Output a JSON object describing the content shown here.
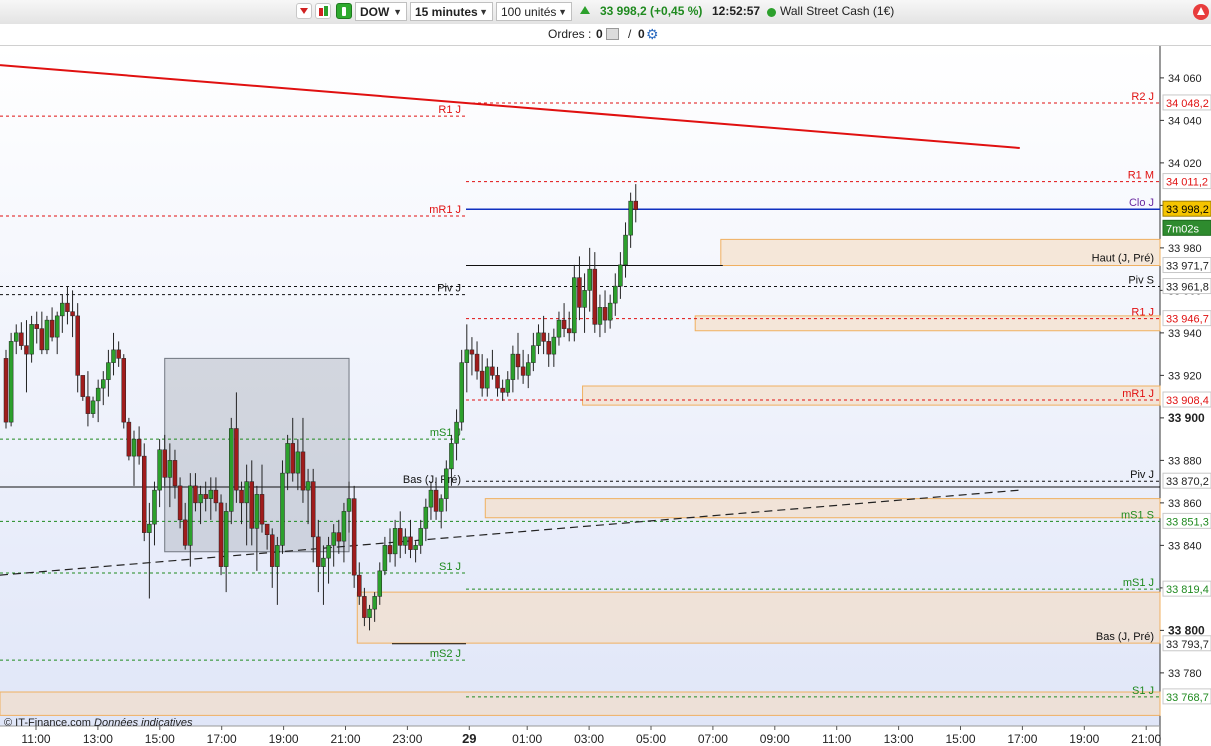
{
  "toolbar": {
    "symbol": "DOW",
    "timeframe": "15 minutes",
    "units": "100 unités",
    "price_change": "33 998,2 (+0,45 %)",
    "time": "12:52:57",
    "instrument": "Wall Street Cash (1€)"
  },
  "orders": {
    "label": "Ordres :",
    "count_a": "0",
    "sep": "/",
    "count_b": "0"
  },
  "footer": {
    "source": "© IT-Finance.com",
    "note": "Données indicatives"
  },
  "colors": {
    "up": "#2ca02c",
    "down": "#a01c1c",
    "resistance": "#e01010",
    "support": "#1f8a1f",
    "pivot": "#111111",
    "zone": "#f5dcc2",
    "zone_border": "#f0b060",
    "box": "#9aa0aa"
  },
  "chart_data": {
    "type": "line",
    "title": "",
    "y_axis": {
      "range": [
        33755,
        34075
      ],
      "tick_labels": [
        "34 060",
        "34 040",
        "34 020",
        "34 000",
        "33 980",
        "33 960",
        "33 940",
        "33 920",
        "33 900",
        "33 880",
        "33 860",
        "33 840",
        "33 820",
        "33 800",
        "33 780"
      ],
      "bold_labels": [
        "33 900",
        "33 800"
      ]
    },
    "x_axis": {
      "tick_labels": [
        "11:00",
        "13:00",
        "15:00",
        "17:00",
        "19:00",
        "21:00",
        "23:00",
        "29",
        "01:00",
        "03:00",
        "05:00",
        "07:00",
        "09:00",
        "11:00",
        "13:00",
        "15:00",
        "17:00",
        "19:00",
        "21:00"
      ],
      "bold_labels": [
        "29"
      ]
    },
    "last_price": {
      "value": "33 998,2",
      "countdown": "7m02s"
    },
    "levels": [
      {
        "label": "R2 J",
        "value": 34048.2,
        "value_label": "34 048,2",
        "kind": "resistance",
        "scope": "today"
      },
      {
        "label": "R1 J",
        "value": 34042,
        "value_label": "",
        "kind": "resistance",
        "scope": "yesterday"
      },
      {
        "label": "R1 M",
        "value": 34011.2,
        "value_label": "34 011,2",
        "kind": "resistance",
        "scope": "today"
      },
      {
        "label": "mR1 J",
        "value": 33995,
        "value_label": "",
        "kind": "resistance",
        "scope": "yesterday"
      },
      {
        "label": "Piv S",
        "value": 33961.8,
        "value_label": "33 961,8",
        "kind": "pivot",
        "scope": "all"
      },
      {
        "label": "Piv J",
        "value": 33958,
        "value_label": "",
        "kind": "pivot",
        "scope": "yesterday"
      },
      {
        "label": "R1 J",
        "value": 33946.7,
        "value_label": "33 946,7",
        "kind": "resistance",
        "scope": "today"
      },
      {
        "label": "mR1 J",
        "value": 33908.4,
        "value_label": "33 908,4",
        "kind": "resistance",
        "scope": "today"
      },
      {
        "label": "mS1 J",
        "value": 33890,
        "value_label": "",
        "kind": "support",
        "scope": "yesterday"
      },
      {
        "label": "Piv J",
        "value": 33870.2,
        "value_label": "33 870,2",
        "kind": "pivot",
        "scope": "today"
      },
      {
        "label": "mS1 S",
        "value": 33851.3,
        "value_label": "33 851,3",
        "kind": "support",
        "scope": "all"
      },
      {
        "label": "S1 J",
        "value": 33827,
        "value_label": "",
        "kind": "support",
        "scope": "yesterday"
      },
      {
        "label": "mS1 J",
        "value": 33819.4,
        "value_label": "33 819,4",
        "kind": "support",
        "scope": "today"
      },
      {
        "label": "mS2 J",
        "value": 33786,
        "value_label": "",
        "kind": "support",
        "scope": "yesterday"
      },
      {
        "label": "S1 J",
        "value": 33768.7,
        "value_label": "33 768,7",
        "kind": "support",
        "scope": "today"
      }
    ],
    "high_low": [
      {
        "label": "Haut (J, Pré)",
        "value": 33971.7,
        "value_label": "33 971,7"
      },
      {
        "label": "Bas (J, Pré)",
        "value": 33793.7,
        "value_label": "33 793,7"
      },
      {
        "label": "Bas (J, Pré)",
        "value": 33867.5,
        "value_label": ""
      }
    ],
    "right_labels": [
      "Clo J"
    ],
    "zones": [
      {
        "low": 33971.7,
        "high": 33984,
        "from_bar": 140
      },
      {
        "low": 33941,
        "high": 33948,
        "from_bar": 135
      },
      {
        "low": 33906,
        "high": 33915,
        "from_bar": 113
      },
      {
        "low": 33853,
        "high": 33862,
        "from_bar": 94
      },
      {
        "low": 33794,
        "high": 33818,
        "from_bar": 69
      },
      {
        "low": 33760,
        "high": 33771,
        "from_bar": 0
      }
    ],
    "consolidation_box": {
      "from_bar": 31,
      "to_bar": 67,
      "low": 33837,
      "high": 33928
    },
    "trendlines": [
      {
        "style": "solid",
        "color": "red",
        "points": [
          [
            0,
            34066
          ],
          [
            198,
            34027
          ]
        ]
      },
      {
        "style": "dashed",
        "color": "black",
        "points": [
          [
            0,
            33826
          ],
          [
            198,
            33866
          ]
        ]
      }
    ],
    "candles_ohlc": [
      [
        33928,
        33932,
        33895,
        33898
      ],
      [
        33898,
        33940,
        33896,
        33936
      ],
      [
        33936,
        33944,
        33930,
        33940
      ],
      [
        33940,
        33945,
        33932,
        33934
      ],
      [
        33934,
        33946,
        33912,
        33930
      ],
      [
        33930,
        33948,
        33926,
        33944
      ],
      [
        33944,
        33950,
        33935,
        33942
      ],
      [
        33942,
        33950,
        33930,
        33932
      ],
      [
        33932,
        33948,
        33930,
        33946
      ],
      [
        33946,
        33952,
        33936,
        33938
      ],
      [
        33938,
        33950,
        33930,
        33948
      ],
      [
        33948,
        33958,
        33940,
        33954
      ],
      [
        33954,
        33962,
        33944,
        33950
      ],
      [
        33950,
        33960,
        33938,
        33948
      ],
      [
        33948,
        33954,
        33912,
        33920
      ],
      [
        33920,
        33912,
        33908,
        33910
      ],
      [
        33910,
        33922,
        33896,
        33902
      ],
      [
        33902,
        33910,
        33900,
        33908
      ],
      [
        33908,
        33918,
        33898,
        33914
      ],
      [
        33914,
        33922,
        33906,
        33918
      ],
      [
        33918,
        33932,
        33910,
        33926
      ],
      [
        33926,
        33940,
        33920,
        33932
      ],
      [
        33932,
        33936,
        33924,
        33928
      ],
      [
        33928,
        33930,
        33895,
        33898
      ],
      [
        33898,
        33900,
        33880,
        33882
      ],
      [
        33882,
        33894,
        33868,
        33890
      ],
      [
        33890,
        33896,
        33878,
        33882
      ],
      [
        33882,
        33888,
        33842,
        33846
      ],
      [
        33846,
        33860,
        33815,
        33850
      ],
      [
        33850,
        33870,
        33840,
        33866
      ],
      [
        33866,
        33890,
        33858,
        33885
      ],
      [
        33885,
        33892,
        33868,
        33872
      ],
      [
        33872,
        33888,
        33858,
        33880
      ],
      [
        33880,
        33885,
        33862,
        33868
      ],
      [
        33868,
        33872,
        33848,
        33852
      ],
      [
        33852,
        33860,
        33838,
        33840
      ],
      [
        33840,
        33874,
        33830,
        33868
      ],
      [
        33868,
        33874,
        33856,
        33860
      ],
      [
        33860,
        33868,
        33850,
        33864
      ],
      [
        33864,
        33870,
        33856,
        33862
      ],
      [
        33862,
        33872,
        33852,
        33866
      ],
      [
        33866,
        33872,
        33856,
        33860
      ],
      [
        33860,
        33864,
        33826,
        33830
      ],
      [
        33830,
        33860,
        33818,
        33856
      ],
      [
        33856,
        33900,
        33850,
        33895
      ],
      [
        33895,
        33912,
        33860,
        33866
      ],
      [
        33866,
        33870,
        33850,
        33860
      ],
      [
        33860,
        33878,
        33840,
        33870
      ],
      [
        33870,
        33880,
        33840,
        33848
      ],
      [
        33848,
        33868,
        33828,
        33864
      ],
      [
        33864,
        33878,
        33846,
        33850
      ],
      [
        33850,
        33850,
        33838,
        33845
      ],
      [
        33845,
        33848,
        33820,
        33830
      ],
      [
        33830,
        33844,
        33812,
        33840
      ],
      [
        33840,
        33880,
        33836,
        33874
      ],
      [
        33874,
        33892,
        33866,
        33888
      ],
      [
        33888,
        33900,
        33870,
        33874
      ],
      [
        33874,
        33890,
        33866,
        33884
      ],
      [
        33884,
        33900,
        33860,
        33866
      ],
      [
        33866,
        33876,
        33850,
        33870
      ],
      [
        33870,
        33876,
        33832,
        33844
      ],
      [
        33844,
        33852,
        33818,
        33830
      ],
      [
        33830,
        33840,
        33812,
        33834
      ],
      [
        33834,
        33844,
        33822,
        33840
      ],
      [
        33840,
        33850,
        33830,
        33846
      ],
      [
        33846,
        33852,
        33836,
        33842
      ],
      [
        33842,
        33860,
        33832,
        33856
      ],
      [
        33856,
        33870,
        33846,
        33862
      ],
      [
        33862,
        33868,
        33820,
        33826
      ],
      [
        33826,
        33832,
        33812,
        33816
      ],
      [
        33816,
        33820,
        33802,
        33806
      ],
      [
        33806,
        33812,
        33800,
        33810
      ],
      [
        33810,
        33818,
        33804,
        33816
      ],
      [
        33816,
        33832,
        33812,
        33828
      ],
      [
        33828,
        33844,
        33826,
        33840
      ],
      [
        33840,
        33848,
        33832,
        33836
      ],
      [
        33836,
        33852,
        33830,
        33848
      ],
      [
        33848,
        33856,
        33834,
        33840
      ],
      [
        33840,
        33848,
        33836,
        33844
      ],
      [
        33844,
        33852,
        33834,
        33838
      ],
      [
        33838,
        33842,
        33832,
        33840
      ],
      [
        33840,
        33852,
        33836,
        33848
      ],
      [
        33848,
        33862,
        33842,
        33858
      ],
      [
        33858,
        33870,
        33852,
        33866
      ],
      [
        33866,
        33872,
        33852,
        33856
      ],
      [
        33856,
        33864,
        33848,
        33862
      ],
      [
        33862,
        33880,
        33856,
        33876
      ],
      [
        33876,
        33892,
        33868,
        33888
      ],
      [
        33888,
        33904,
        33880,
        33898
      ],
      [
        33898,
        33932,
        33894,
        33926
      ],
      [
        33926,
        33944,
        33912,
        33932
      ],
      [
        33932,
        33938,
        33920,
        33930
      ],
      [
        33930,
        33936,
        33918,
        33922
      ],
      [
        33922,
        33930,
        33910,
        33914
      ],
      [
        33914,
        33928,
        33910,
        33924
      ],
      [
        33924,
        33932,
        33918,
        33920
      ],
      [
        33920,
        33924,
        33910,
        33914
      ],
      [
        33914,
        33918,
        33908,
        33912
      ],
      [
        33912,
        33922,
        33910,
        33918
      ],
      [
        33918,
        33934,
        33912,
        33930
      ],
      [
        33930,
        33940,
        33918,
        33924
      ],
      [
        33924,
        33932,
        33916,
        33920
      ],
      [
        33920,
        33930,
        33914,
        33926
      ],
      [
        33926,
        33940,
        33922,
        33934
      ],
      [
        33934,
        33944,
        33930,
        33940
      ],
      [
        33940,
        33948,
        33930,
        33936
      ],
      [
        33936,
        33940,
        33924,
        33930
      ],
      [
        33930,
        33942,
        33924,
        33938
      ],
      [
        33938,
        33950,
        33934,
        33946
      ],
      [
        33946,
        33954,
        33938,
        33942
      ],
      [
        33942,
        33950,
        33936,
        33940
      ],
      [
        33940,
        33972,
        33936,
        33966
      ],
      [
        33966,
        33976,
        33946,
        33952
      ],
      [
        33952,
        33968,
        33940,
        33960
      ],
      [
        33960,
        33980,
        33950,
        33970
      ],
      [
        33970,
        33978,
        33940,
        33944
      ],
      [
        33944,
        33958,
        33938,
        33952
      ],
      [
        33952,
        33960,
        33940,
        33946
      ],
      [
        33946,
        33958,
        33942,
        33954
      ],
      [
        33954,
        33968,
        33948,
        33962
      ],
      [
        33962,
        33978,
        33956,
        33972
      ],
      [
        33972,
        33992,
        33966,
        33986
      ],
      [
        33986,
        34006,
        33980,
        34002
      ],
      [
        34002,
        34010,
        33992,
        33998
      ]
    ]
  }
}
